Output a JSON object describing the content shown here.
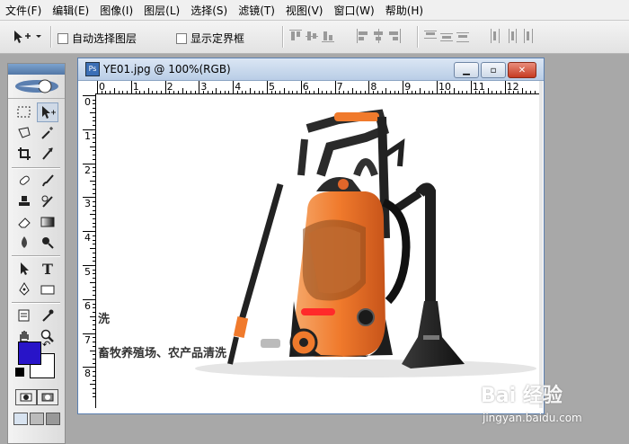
{
  "menu": [
    "文件(F)",
    "编辑(E)",
    "图像(I)",
    "图层(L)",
    "选择(S)",
    "滤镜(T)",
    "视图(V)",
    "窗口(W)",
    "帮助(H)"
  ],
  "options": {
    "auto_select_label": "自动选择图层",
    "show_bounds_label": "显示定界框"
  },
  "document": {
    "title": "YE01.jpg @ 100%(RGB)",
    "ruler_top": [
      "0",
      "1",
      "2",
      "3",
      "4",
      "5",
      "6",
      "7",
      "8",
      "9",
      "10",
      "11",
      "12"
    ],
    "ruler_left": [
      "0",
      "1",
      "2",
      "3",
      "4",
      "5",
      "6",
      "7",
      "8"
    ],
    "caption_line1": "洗",
    "caption_line2": "畜牧养殖场、农产品清洗"
  },
  "colors": {
    "foreground": "#2814c8",
    "background": "#ffffff",
    "machine_orange": "#f07a2c"
  },
  "watermark": {
    "brand": "Bai  经验",
    "url": "jingyan.baidu.com"
  }
}
